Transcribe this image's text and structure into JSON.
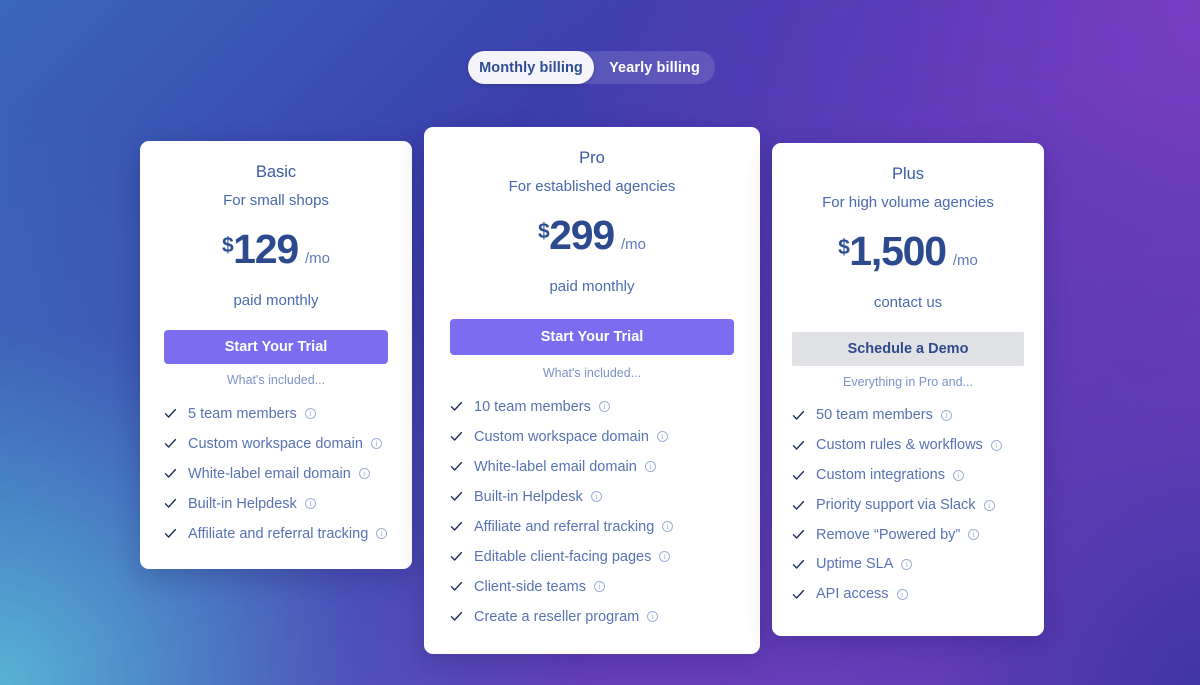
{
  "billing_toggle": {
    "monthly_label": "Monthly billing",
    "yearly_label": "Yearly billing",
    "active": "Monthly billing"
  },
  "colors": {
    "accent_button": "#7c6df0",
    "secondary_button": "#e1e2e6",
    "price_text": "#2c4a8e",
    "feature_text": "#5872b4",
    "toggle_active_bg": "#f4f4fa",
    "bg_gradient_start": "#3a66bd",
    "bg_gradient_end": "#7a42c4"
  },
  "plans": [
    {
      "name": "Basic",
      "tagline": "For small shops",
      "currency": "$",
      "amount": "129",
      "period": "/mo",
      "billing_note": "paid monthly",
      "cta_label": "Start Your Trial",
      "cta_style": "primary",
      "included_label": "What's included...",
      "features": [
        "5 team members",
        "Custom workspace domain",
        "White-label email domain",
        "Built-in Helpdesk",
        "Affiliate and referral tracking"
      ]
    },
    {
      "name": "Pro",
      "tagline": "For established agencies",
      "currency": "$",
      "amount": "299",
      "period": "/mo",
      "billing_note": "paid monthly",
      "cta_label": "Start Your Trial",
      "cta_style": "primary",
      "included_label": "What's included...",
      "features": [
        "10 team members",
        "Custom workspace domain",
        "White-label email domain",
        "Built-in Helpdesk",
        "Affiliate and referral tracking",
        "Editable client-facing pages",
        "Client-side teams",
        "Create a reseller program"
      ]
    },
    {
      "name": "Plus",
      "tagline": "For high volume agencies",
      "currency": "$",
      "amount": "1,500",
      "period": "/mo",
      "billing_note": "contact us",
      "cta_label": "Schedule a Demo",
      "cta_style": "secondary",
      "included_label": "Everything in Pro and...",
      "features": [
        "50 team members",
        "Custom rules & workflows",
        "Custom integrations",
        "Priority support via Slack",
        "Remove “Powered by”",
        "Uptime SLA",
        "API access"
      ]
    }
  ],
  "icons": {
    "check": "check-icon",
    "info": "info-icon",
    "info_glyph": "i"
  }
}
